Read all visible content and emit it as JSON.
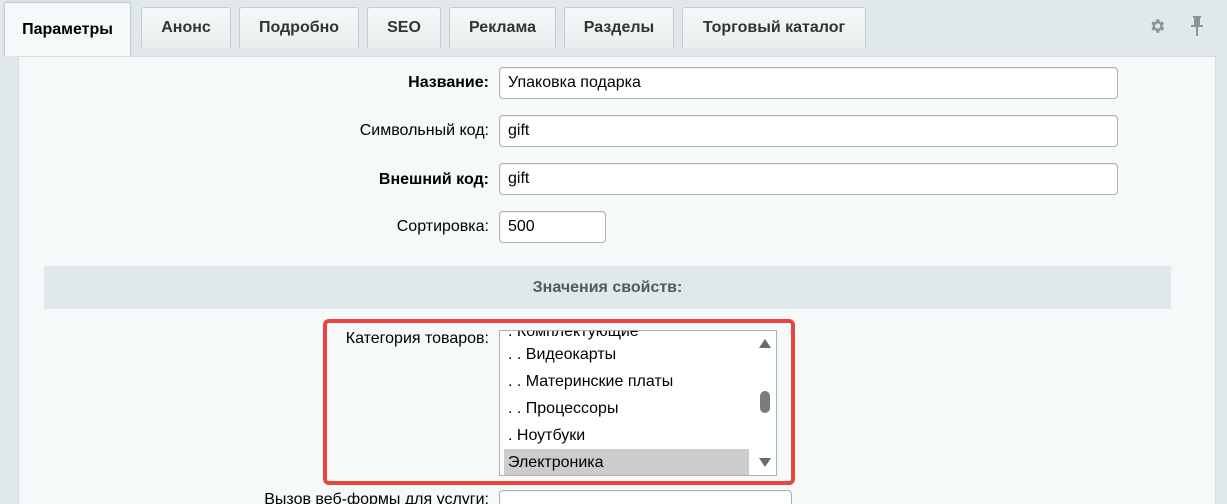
{
  "tabs": [
    {
      "label": "Параметры",
      "active": true
    },
    {
      "label": "Анонс",
      "active": false
    },
    {
      "label": "Подробно",
      "active": false
    },
    {
      "label": "SEO",
      "active": false
    },
    {
      "label": "Реклама",
      "active": false
    },
    {
      "label": "Разделы",
      "active": false
    },
    {
      "label": "Торговый каталог",
      "active": false
    }
  ],
  "icons": {
    "settings": "gear-icon",
    "pin": "pin-icon"
  },
  "form": {
    "name_label": "Название:",
    "name_value": "Упаковка подарка",
    "code_label": "Символьный код:",
    "code_value": "gift",
    "external_label": "Внешний код:",
    "external_value": "gift",
    "sort_label": "Сортировка:",
    "sort_value": "500"
  },
  "properties": {
    "header": "Значения свойств:",
    "category_label": "Категория товаров:",
    "category_options": [
      ". Комплектующие",
      ". . Видеокарты",
      ". . Материнские платы",
      ". . Процессоры",
      ". Ноутбуки",
      "Электроника"
    ],
    "selected_option": "Электроника",
    "webform_label": "Вызов веб-формы для услуги:"
  },
  "colors": {
    "highlight": "#e8453c",
    "selected": "#cccccc"
  }
}
